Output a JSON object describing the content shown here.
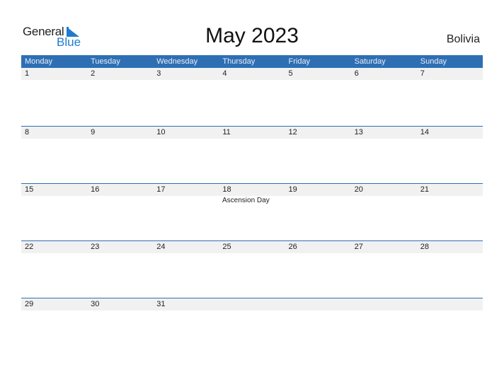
{
  "logo": {
    "word1": "General",
    "word2": "Blue"
  },
  "title": "May 2023",
  "country": "Bolivia",
  "colors": {
    "accent": "#2e6fb4",
    "date_strip": "#f1f1f1",
    "logo_blue": "#1f7bd0"
  },
  "weekdays": [
    "Monday",
    "Tuesday",
    "Wednesday",
    "Thursday",
    "Friday",
    "Saturday",
    "Sunday"
  ],
  "weeks": [
    [
      "1",
      "2",
      "3",
      "4",
      "5",
      "6",
      "7"
    ],
    [
      "8",
      "9",
      "10",
      "11",
      "12",
      "13",
      "14"
    ],
    [
      "15",
      "16",
      "17",
      "18",
      "19",
      "20",
      "21"
    ],
    [
      "22",
      "23",
      "24",
      "25",
      "26",
      "27",
      "28"
    ],
    [
      "29",
      "30",
      "31"
    ]
  ],
  "events": [
    {
      "date": "18",
      "label": "Ascension Day"
    }
  ]
}
